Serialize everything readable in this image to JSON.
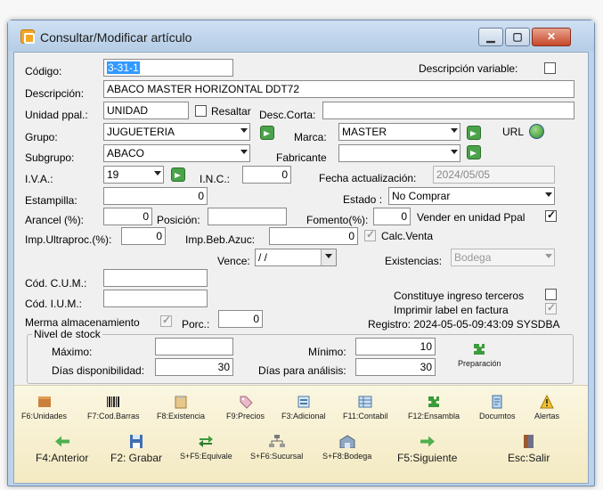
{
  "window": {
    "title": "Consultar/Modificar artículo",
    "min": "▁",
    "max": "▢",
    "close": "✕"
  },
  "form": {
    "codigo_label": "Código:",
    "codigo_value": "3-31-1",
    "desc_variable_label": "Descripción variable:",
    "descripcion_label": "Descripción:",
    "descripcion_value": "ABACO MASTER HORIZONTAL DDT72",
    "unidad_label": "Unidad ppal.:",
    "unidad_value": "UNIDAD",
    "resaltar_label": "Resaltar",
    "desc_corta_label": "Desc.Corta:",
    "grupo_label": "Grupo:",
    "grupo_value": "JUGUETERIA",
    "marca_label": "Marca:",
    "marca_value": "MASTER",
    "url_label": "URL",
    "subgrupo_label": "Subgrupo:",
    "subgrupo_value": "ABACO",
    "fabricante_label": "Fabricante",
    "iva_label": "I.V.A.:",
    "iva_value": "19",
    "inc_label": "I.N.C.:",
    "inc_value": "0",
    "fecha_label": "Fecha actualización:",
    "fecha_value": "2024/05/05",
    "estampilla_label": "Estampilla:",
    "estampilla_value": "0",
    "estado_label": "Estado :",
    "estado_value": "No Comprar",
    "arancel_label": "Arancel (%):",
    "arancel_value": "0",
    "posicion_label": "Posición:",
    "fomento_label": "Fomento(%):",
    "fomento_value": "0",
    "vender_label": "Vender en unidad Ppal",
    "impultra_label": "Imp.Ultraproc.(%):",
    "impultra_value": "0",
    "impbeb_label": "Imp.Beb.Azuc:",
    "impbeb_value": "0",
    "calc_label": "Calc.Venta",
    "vence_label": "Vence:",
    "vence_value": " /  /",
    "existencias_label": "Existencias:",
    "existencias_value": "Bodega",
    "cum_label": "Cód. C.U.M.:",
    "ium_label": "Cód. I.U.M.:",
    "terceros_label": "Constituye ingreso terceros",
    "imprimir_label": "Imprimir label en factura",
    "merma_label": "Merma almacenamiento",
    "porc_label": "Porc.:",
    "porc_value": "0",
    "registro_text": "Registro: 2024-05-05-09:43:09 SYSDBA"
  },
  "stock": {
    "group_label": "Nivel de stock",
    "maximo_label": "Máximo:",
    "minimo_label": "Mínimo:",
    "minimo_value": "10",
    "dias_disp_label": "Días disponibilidad:",
    "dias_disp_value": "30",
    "dias_anal_label": "Días para análisis:",
    "dias_anal_value": "30",
    "preparacion_label": "Preparación"
  },
  "toolbar": {
    "row1": [
      "F6:Unidades",
      "F7:Cod.Barras",
      "F8:Existencia",
      "F9:Precios",
      "F3:Adicional",
      "F11:Contabil",
      "F12:Ensambla",
      "Documtos",
      "Alertas"
    ],
    "row2": [
      "F4:Anterior",
      "F2: Grabar",
      "S+F5:Equivale",
      "S+F6:Sucursal",
      "S+F8:Bodega",
      "F5:Siguiente",
      "Esc:Salir"
    ]
  },
  "colors": {
    "accent": "#3399ff",
    "toolbar_bg": "#f5edc8",
    "frame": "#bcd3ea",
    "ok_green": "#4aa34a"
  }
}
